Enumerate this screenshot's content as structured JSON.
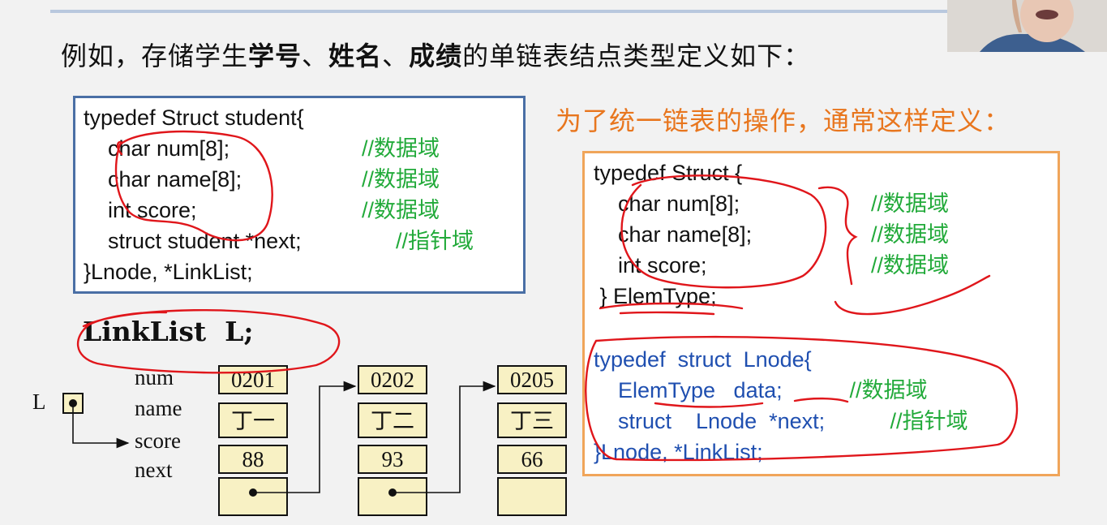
{
  "title": {
    "p1": "例如，存储学生",
    "b1": "学号",
    "p2": "、",
    "b2": "姓名",
    "p3": "、",
    "b3": "成绩",
    "p4": "的单链表结点类型定义如下："
  },
  "subtitle": "为了统一链表的操作，通常这样定义：",
  "code1": {
    "l1": "typedef Struct student{",
    "l2": "    char num[8];",
    "l2c": "//数据域",
    "l3": "    char name[8];",
    "l3c": "//数据域",
    "l4": "    int score;",
    "l4c": "//数据域",
    "l5": "    struct student *next;",
    "l5c": "//指针域",
    "l6": "}Lnode, *LinkList;"
  },
  "declaration": "LinkList  L;",
  "code2": {
    "l1": "typedef Struct {",
    "l2": "    char num[8];",
    "l2c": "//数据域",
    "l3": "    char name[8];",
    "l3c": "//数据域",
    "l4": "    int score;",
    "l4c": "//数据域",
    "l5": " } ElemType;",
    "b1": "typedef  struct  Lnode{",
    "b2a": "    ElemType   data;",
    "b2c": " //数据域",
    "b3a": "    struct    Lnode  *next;",
    "b3c": " //指针域",
    "b4": "}Lnode, *LinkList;"
  },
  "diagram": {
    "head_label": "L",
    "field_labels": [
      "num",
      "name",
      "score",
      "next"
    ],
    "nodes": [
      {
        "num": "0201",
        "name": "丁一",
        "score": "88",
        "next_null": false
      },
      {
        "num": "0202",
        "name": "丁二",
        "score": "93",
        "next_null": false
      },
      {
        "num": "0205",
        "name": "丁三",
        "score": "66",
        "next_null": true
      }
    ]
  },
  "colors": {
    "annotation": "#e0161b",
    "comment": "#22aa3a",
    "keyword_blue": "#1f4fb0",
    "subtitle": "#e8761e"
  }
}
